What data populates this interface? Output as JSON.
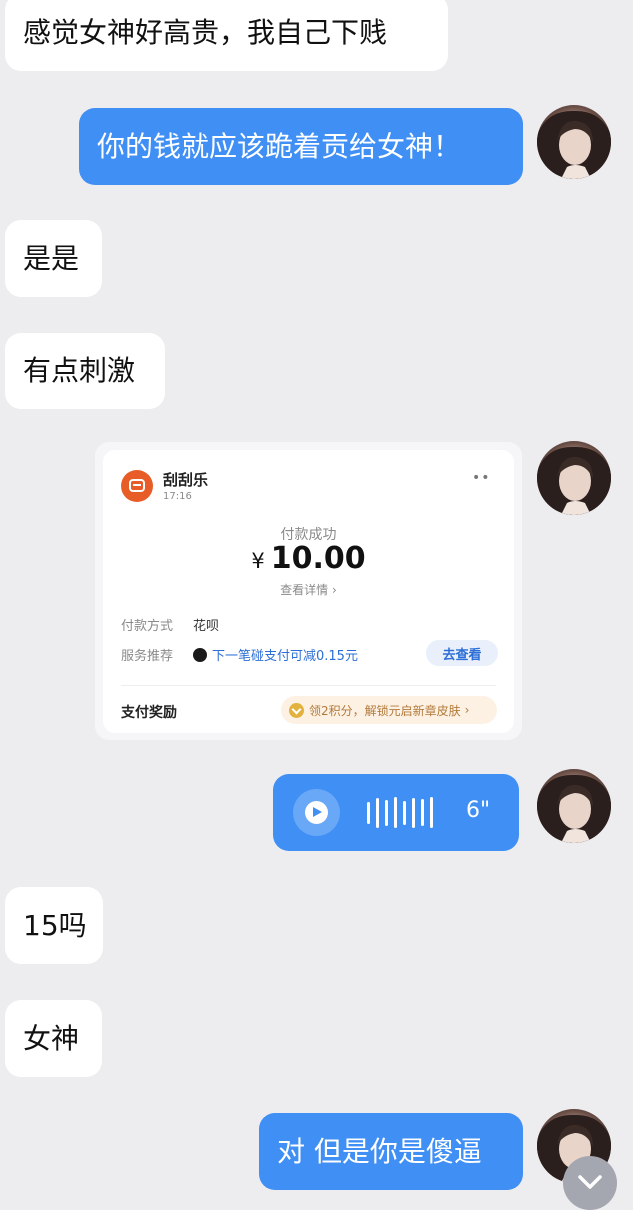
{
  "messages": {
    "m1": {
      "text": "感觉女神好高贵，我自己下贱"
    },
    "m2": {
      "text": "你的钱就应该跪着贡给女神！"
    },
    "m3": {
      "text": "是是"
    },
    "m4": {
      "text": "有点刺激"
    },
    "m6": {
      "duration": "6\""
    },
    "m7": {
      "text": "15吗"
    },
    "m8": {
      "text": "女神"
    },
    "m9": {
      "text": "对 但是你是傻逼"
    }
  },
  "payment": {
    "merchant": "刮刮乐",
    "time": "17:16",
    "more": "••",
    "status": "付款成功",
    "currency": "¥",
    "amount": "10.00",
    "detail_link": "查看详情",
    "method_label": "付款方式",
    "method_value": "花呗",
    "service_label": "服务推荐",
    "service_promo": "下一笔碰支付可减0.15元",
    "service_button": "去查看",
    "reward_label": "支付奖励",
    "reward_text": "领2积分，解锁元启新章皮肤"
  },
  "colors": {
    "background": "#ededf0",
    "sent_bubble": "#3f8ff5",
    "received_bubble": "#ffffff"
  },
  "icons": {
    "play": "play-icon",
    "scroll": "chevron-down-icon",
    "logo": "scratch-card-logo-icon"
  }
}
